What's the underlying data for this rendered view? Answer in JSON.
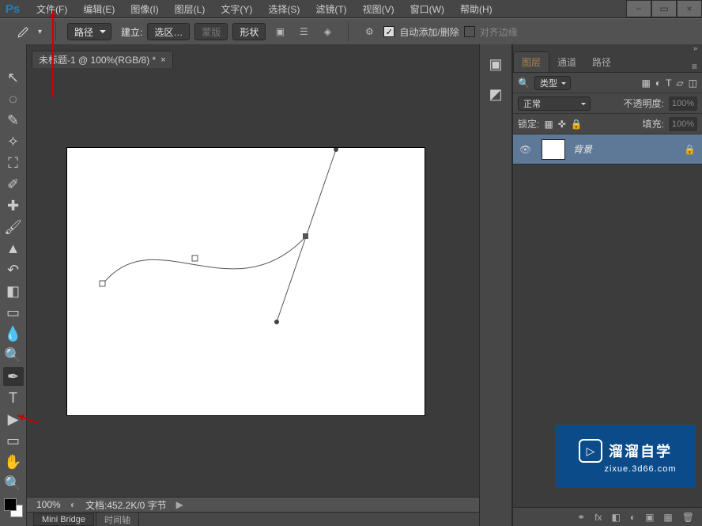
{
  "menu": {
    "items": [
      "文件(F)",
      "编辑(E)",
      "图像(I)",
      "图层(L)",
      "文字(Y)",
      "选择(S)",
      "滤镜(T)",
      "视图(V)",
      "窗口(W)",
      "帮助(H)"
    ]
  },
  "options": {
    "tool_mode": "路径",
    "label_create": "建立:",
    "btn_selection": "选区…",
    "btn_mask": "蒙版",
    "btn_shape": "形状",
    "auto_add_delete": "自动添加/删除",
    "align_edges": "对齐边缘"
  },
  "doc": {
    "tab": "未标题-1 @ 100%(RGB/8) *",
    "zoom": "100%",
    "status": "文档:452.2K/0 字节"
  },
  "panels": {
    "tabs": {
      "layers": "图层",
      "channels": "通道",
      "paths": "路径"
    },
    "filter_kind": "类型",
    "blend_mode": "正常",
    "opacity_label": "不透明度:",
    "opacity_value": "100%",
    "lock_label": "锁定:",
    "fill_label": "填充:",
    "fill_value": "100%",
    "bg_layer": "背景"
  },
  "bottom_tabs": {
    "mini_bridge": "Mini Bridge",
    "timeline": "时间轴"
  },
  "watermark": {
    "title": "溜溜自学",
    "subtitle": "zixue.3d66.com"
  }
}
